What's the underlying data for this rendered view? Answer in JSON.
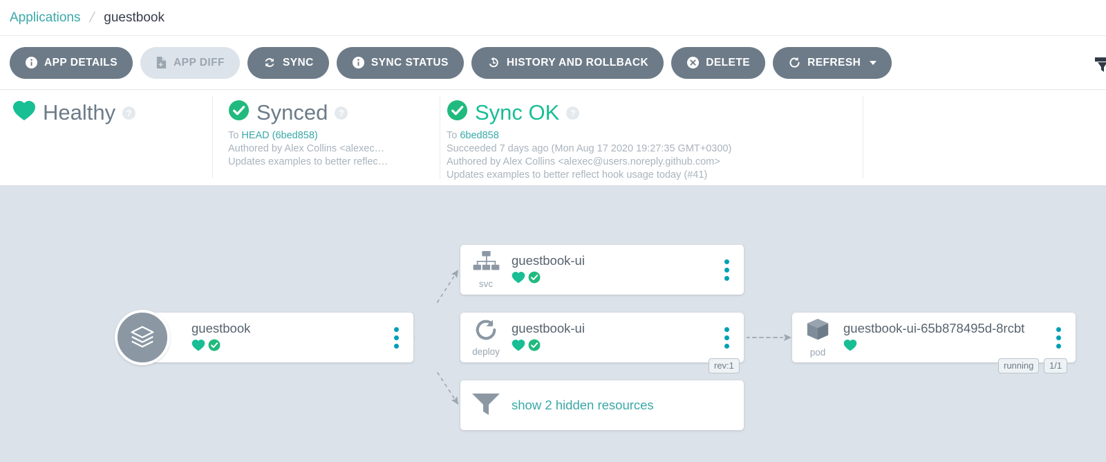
{
  "breadcrumb": {
    "root": "Applications",
    "separator": "/",
    "current": "guestbook"
  },
  "toolbar": {
    "buttons": [
      {
        "label": "APP DETAILS",
        "icon": "info-icon",
        "disabled": false
      },
      {
        "label": "APP DIFF",
        "icon": "file-diff-icon",
        "disabled": true
      },
      {
        "label": "SYNC",
        "icon": "sync-icon",
        "disabled": false
      },
      {
        "label": "SYNC STATUS",
        "icon": "info-icon",
        "disabled": false
      },
      {
        "label": "HISTORY AND ROLLBACK",
        "icon": "history-icon",
        "disabled": false
      },
      {
        "label": "DELETE",
        "icon": "close-circle-icon",
        "disabled": false
      },
      {
        "label": "REFRESH",
        "icon": "refresh-icon",
        "disabled": false,
        "caret": true
      }
    ]
  },
  "status": {
    "health": {
      "title": "Healthy",
      "help": "?"
    },
    "sync": {
      "title": "Synced",
      "help": "?",
      "line1_prefix": "To ",
      "line1_link": "HEAD (6bed858)",
      "line2": "Authored by Alex Collins <alexec…",
      "line3": "Updates examples to better reflec…"
    },
    "operation": {
      "title": "Sync OK",
      "help": "?",
      "line1_prefix": "To ",
      "line1_link": "6bed858",
      "line2": "Succeeded 7 days ago (Mon Aug 17 2020 19:27:35 GMT+0300)",
      "line3": "Authored by Alex Collins <alexec@users.noreply.github.com>",
      "line4": "Updates examples to better reflect hook usage today (#41)"
    }
  },
  "graph": {
    "app_node": {
      "name": "guestbook",
      "icon": "application-layers-icon",
      "health": "healthy-heart-icon",
      "sync": "synced-check-icon"
    },
    "nodes": [
      {
        "kind": "svc",
        "icon": "service-sitemap-icon",
        "name": "guestbook-ui",
        "health": "healthy-heart-icon",
        "sync": "synced-check-icon",
        "badges": []
      },
      {
        "kind": "deploy",
        "icon": "deployment-rotate-icon",
        "name": "guestbook-ui",
        "health": "healthy-heart-icon",
        "sync": "synced-check-icon",
        "badges": [
          "rev:1"
        ]
      },
      {
        "kind": "pod",
        "icon": "pod-cube-icon",
        "name": "guestbook-ui-65b878495d-8rcbt",
        "health": "healthy-heart-icon",
        "sync": null,
        "badges": [
          "running",
          "1/1"
        ]
      }
    ],
    "hidden_resources": {
      "icon": "filter-funnel-icon",
      "label": "show 2 hidden resources"
    }
  },
  "colors": {
    "background": "#dce2e9",
    "button": "#6d7b88",
    "button_disabled": "#dde3ea",
    "accent_teal": "#3aa8a8",
    "kebab_teal": "#00a0b4",
    "health_green": "#18be94",
    "sync_green": "#21ba7e"
  }
}
